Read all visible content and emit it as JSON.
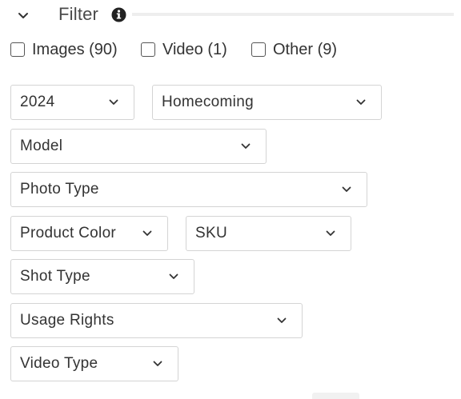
{
  "filter": {
    "title": "Filter",
    "toggle_icon": "chevron-down-icon",
    "info_icon": "info-circle-icon"
  },
  "checkboxes": [
    {
      "label": "Images (90)",
      "checked": false
    },
    {
      "label": "Video (1)",
      "checked": false
    },
    {
      "label": "Other (9)",
      "checked": false
    }
  ],
  "selects": {
    "year": {
      "value": "2024"
    },
    "event": {
      "value": "Homecoming"
    },
    "model": {
      "value": "Model"
    },
    "photo_type": {
      "value": "Photo Type"
    },
    "product_color": {
      "value": "Product Color"
    },
    "sku": {
      "value": "SKU"
    },
    "shot_type": {
      "value": "Shot Type"
    },
    "usage_rights": {
      "value": "Usage Rights"
    },
    "video_type": {
      "value": "Video Type"
    }
  },
  "colors": {
    "border": "#d4d4d4",
    "text": "#333333",
    "rule": "#eeeeee"
  }
}
